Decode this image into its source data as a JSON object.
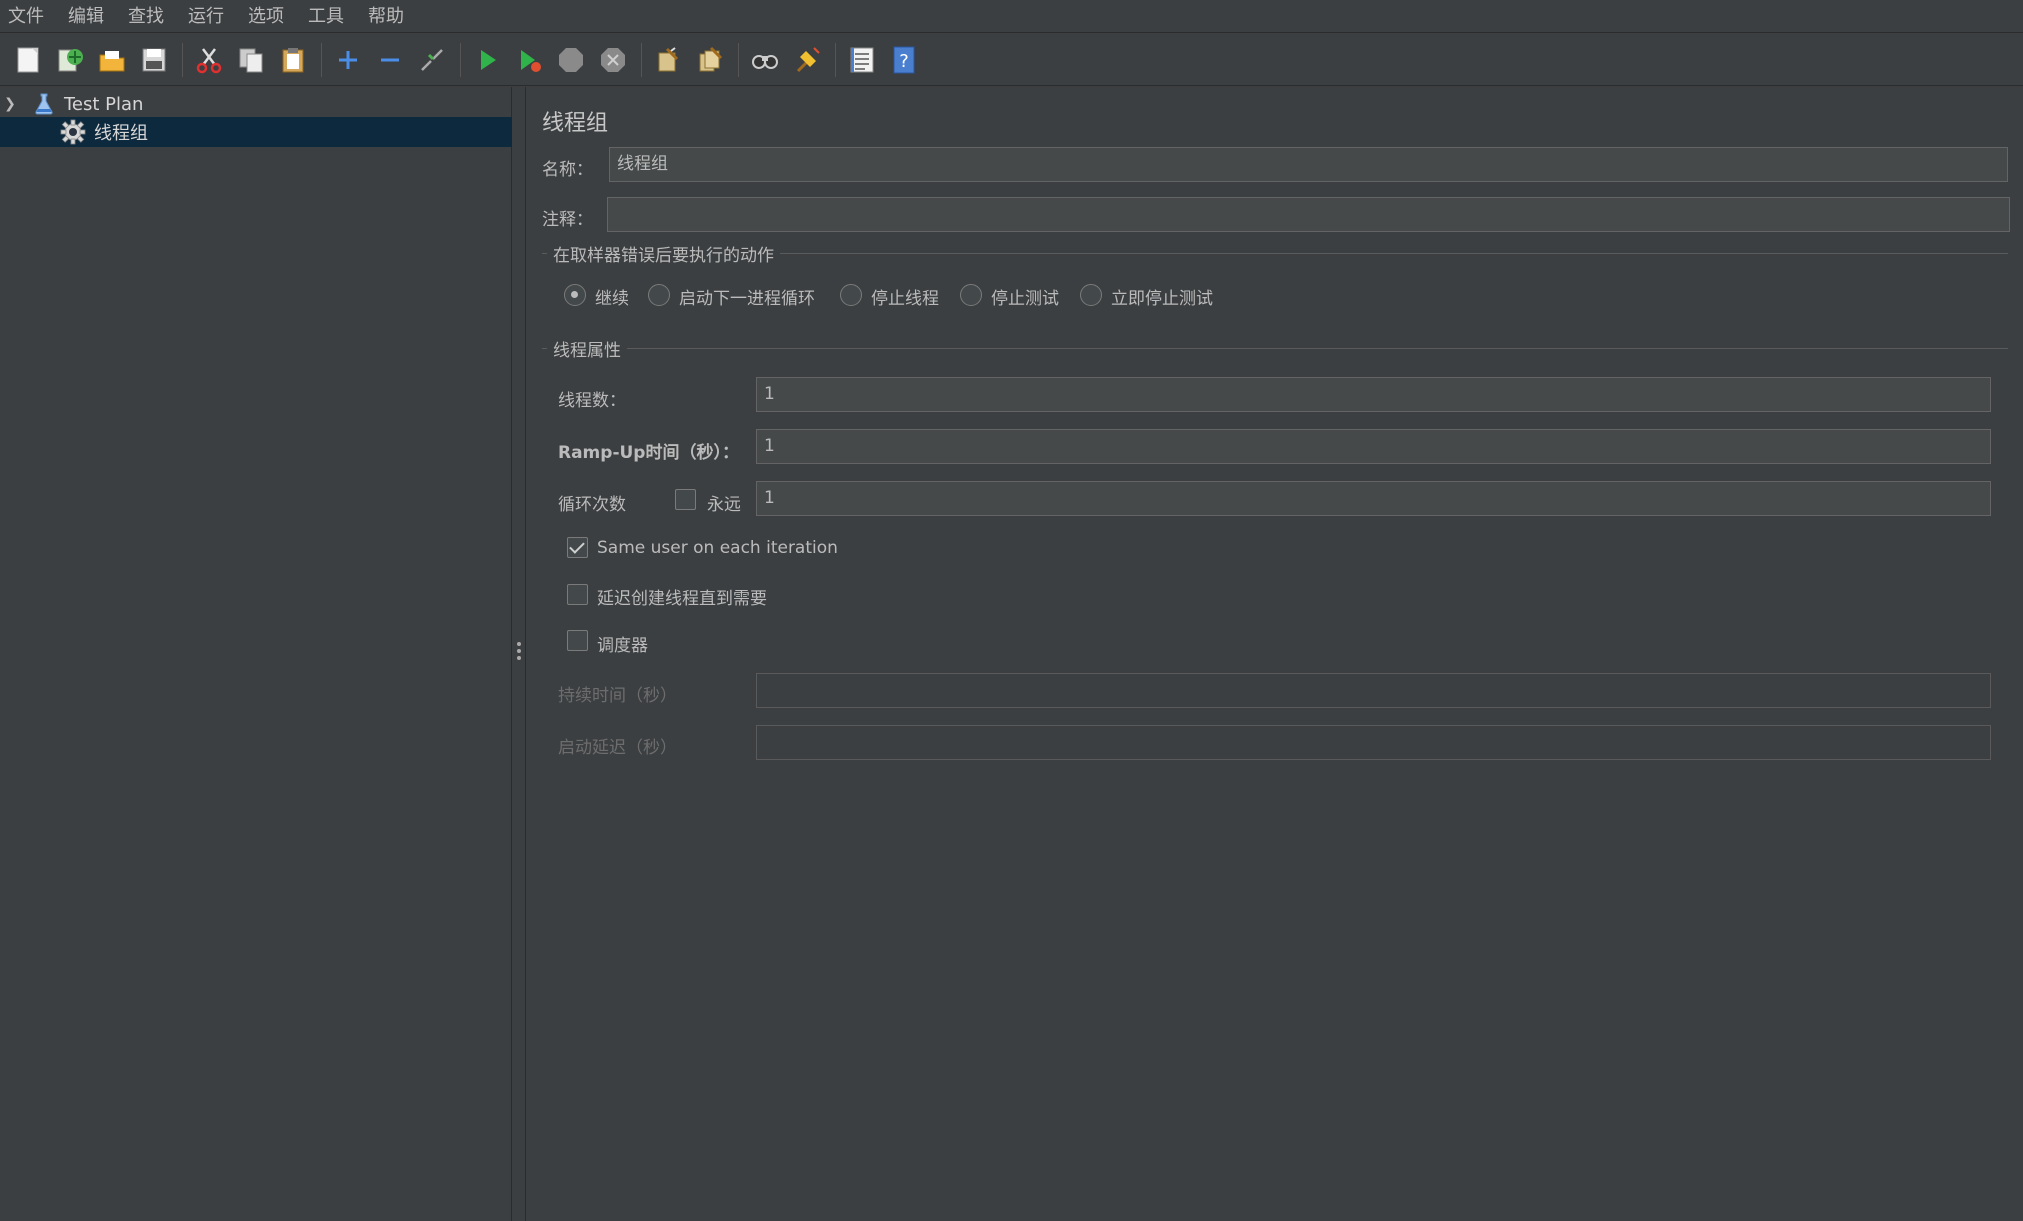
{
  "menu": [
    "文件",
    "编辑",
    "查找",
    "运行",
    "选项",
    "工具",
    "帮助"
  ],
  "toolbar": {
    "icons": [
      "new-file-icon",
      "templates-icon",
      "open-icon",
      "save-icon",
      "cut-icon",
      "copy-icon",
      "paste-icon",
      "expand-icon",
      "collapse-icon",
      "toggle-icon",
      "start-icon",
      "start-no-pause-icon",
      "stop-icon",
      "shutdown-icon",
      "clear-icon",
      "clear-all-icon",
      "search-icon",
      "reset-search-icon",
      "function-helper-icon",
      "help-icon"
    ]
  },
  "tree": {
    "root_label": "Test Plan",
    "child_label": "线程组"
  },
  "panel": {
    "title": "线程组",
    "name_label": "名称：",
    "name_value": "线程组",
    "comment_label": "注释：",
    "comment_value": "",
    "error_group_title": "在取样器错误后要执行的动作",
    "error_actions": [
      "继续",
      "启动下一进程循环",
      "停止线程",
      "停止测试",
      "立即停止测试"
    ],
    "error_selected": "继续",
    "thread_group_title": "线程属性",
    "threads_label": "线程数：",
    "threads_value": "1",
    "rampup_label": "Ramp-Up时间（秒）：",
    "rampup_value": "1",
    "loop_label": "循环次数",
    "forever_label": "永远",
    "loop_value": "1",
    "same_user_label": "Same user on each iteration",
    "delay_label": "延迟创建线程直到需要",
    "scheduler_label": "调度器",
    "duration_label": "持续时间（秒）",
    "duration_value": "",
    "startup_delay_label": "启动延迟（秒）",
    "startup_delay_value": ""
  },
  "colors": {
    "background": "#3c3f41",
    "selection": "#0d293e",
    "input_bg": "#45494a",
    "text": "#bbbbbb"
  }
}
